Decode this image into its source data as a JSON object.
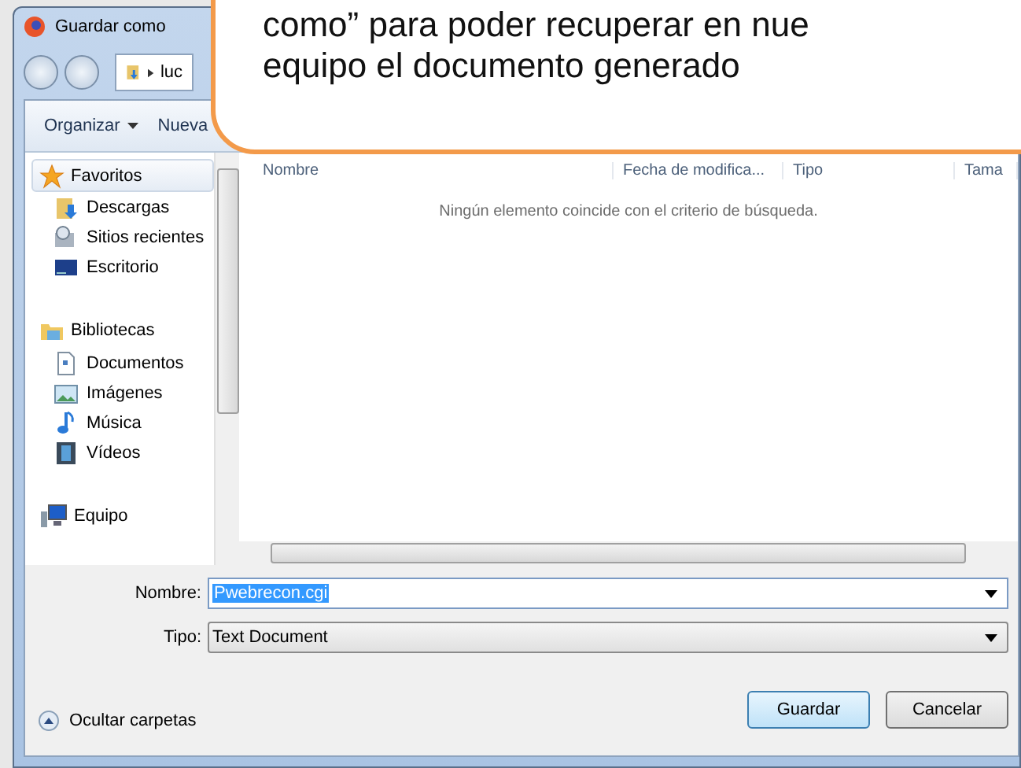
{
  "callout": {
    "lines": [
      "como” para poder recuperar en nue",
      "equipo el documento generado"
    ]
  },
  "window": {
    "title": "Guardar como"
  },
  "breadcrumb": {
    "text": "luc"
  },
  "toolbar": {
    "items": [
      {
        "label": "Organizar",
        "kind": "menu"
      },
      {
        "label": "Nueva",
        "kind": "button"
      }
    ]
  },
  "sidebar": {
    "groups": [
      {
        "label": "Favoritos",
        "kind": "star",
        "selected": true,
        "children": [
          {
            "label": "Descargas",
            "kind": "download"
          },
          {
            "label": "Sitios recientes",
            "kind": "recent"
          },
          {
            "label": "Escritorio",
            "kind": "desktop"
          }
        ]
      },
      {
        "label": "Bibliotecas",
        "kind": "library",
        "selected": false,
        "children": [
          {
            "label": "Documentos",
            "kind": "document"
          },
          {
            "label": "Imágenes",
            "kind": "image"
          },
          {
            "label": "Música",
            "kind": "music"
          },
          {
            "label": "Vídeos",
            "kind": "video"
          }
        ]
      },
      {
        "label": "Equipo",
        "kind": "computer",
        "selected": false
      }
    ]
  },
  "table": {
    "columns": [
      "Nombre",
      "Fecha de modifica...",
      "Tipo",
      "Tama"
    ],
    "empty_message": "Ningún elemento coincide con el criterio de búsqueda."
  },
  "form": {
    "name_label": "Nombre:",
    "name_value": "Pwebrecon.cgi",
    "type_label": "Tipo:",
    "type_value": "Text Document"
  },
  "hide_folders": "Ocultar carpetas",
  "buttons": [
    {
      "label": "Guardar",
      "default": true
    },
    {
      "label": "Cancelar",
      "default": false
    }
  ]
}
